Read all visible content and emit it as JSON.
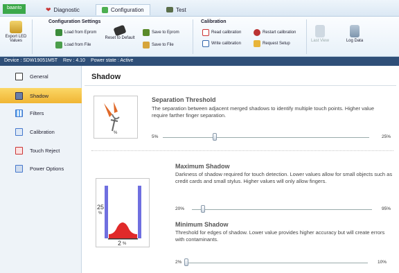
{
  "app": {
    "name": "baanto"
  },
  "tabs": [
    {
      "label": "Diagnostic",
      "icon": "heart-icon"
    },
    {
      "label": "Configuration",
      "icon": "configuration-icon",
      "active": true
    },
    {
      "label": "Test",
      "icon": "test-icon"
    }
  ],
  "ribbon": {
    "export_led": "Export LED Values",
    "config_group": "Configuration Settings",
    "load_eprom": "Load from Eprom",
    "load_file": "Load from File",
    "reset_default": "Reset to Default",
    "save_eprom": "Save to Eprom",
    "save_file": "Save to File",
    "calibration_group": "Calibration",
    "read_cal": "Read calibration",
    "write_cal": "Write calibration",
    "restart_cal": "Restart calibration",
    "request_setup": "Request Setup",
    "last_view": "Last View",
    "log_data": "Log Data"
  },
  "status": {
    "device": "Device : SDW19051M5T",
    "rev": "Rev : 4.10",
    "power": "Power state : Active"
  },
  "sidebar": {
    "items": [
      {
        "label": "General",
        "icon": "general-icon"
      },
      {
        "label": "Shadow",
        "icon": "shadow-icon",
        "active": true
      },
      {
        "label": "Filters",
        "icon": "filters-icon"
      },
      {
        "label": "Calibration",
        "icon": "calibration-icon"
      },
      {
        "label": "Touch Reject",
        "icon": "touch-reject-icon"
      },
      {
        "label": "Power Options",
        "icon": "power-options-icon"
      }
    ]
  },
  "main": {
    "title": "Shadow",
    "separation": {
      "title": "Separation Threshold",
      "desc": "The separation between adjacent merged shadows to identify multiple touch points.  Higher value require farther finger separation.",
      "min": "5%",
      "max": "25%",
      "value": 0.25,
      "image_label": "%"
    },
    "max_shadow": {
      "title": "Maximum Shadow",
      "desc": "Darkness of shadow required for touch detection.  Lower values allow for small objects such as credit cards and small stylus.  Higher values will only allow fingers.",
      "min": "20%",
      "max": "95%",
      "value": 0.06
    },
    "min_shadow": {
      "title": "Minimum Shadow",
      "desc": "Threshold for edges of shadow.  Lower value provides higher accuracy but will create errors with contaminants.",
      "min": "2%",
      "max": "10%",
      "value": 0.0
    },
    "shadow_image": {
      "left_label": "25",
      "left_unit": "%",
      "bottom_label": "2",
      "bottom_unit": "%"
    }
  }
}
